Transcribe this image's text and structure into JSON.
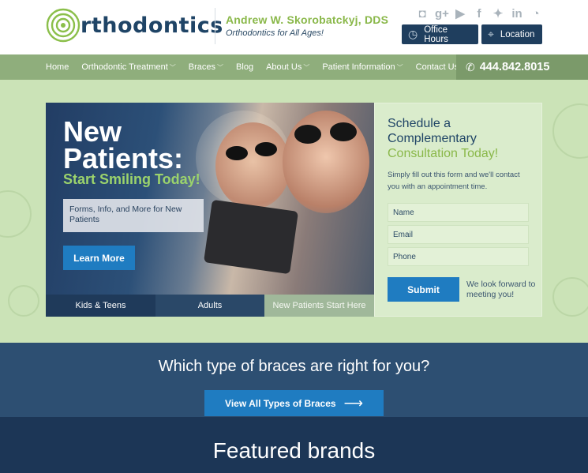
{
  "brand": {
    "logo_text": "rthodontics",
    "doctor_name": "Andrew W. Skorobatckyj, DDS",
    "tagline": "Orthodontics for All Ages!"
  },
  "social": [
    "instagram-icon",
    "google-plus-icon",
    "youtube-icon",
    "facebook-icon",
    "twitter-icon",
    "linkedin-icon",
    "rss-icon"
  ],
  "header_buttons": {
    "office_hours": "Office Hours",
    "location": "Location"
  },
  "nav": {
    "items": [
      {
        "label": "Home",
        "dropdown": false
      },
      {
        "label": "Orthodontic Treatment",
        "dropdown": true
      },
      {
        "label": "Braces",
        "dropdown": true
      },
      {
        "label": "Blog",
        "dropdown": false
      },
      {
        "label": "About Us",
        "dropdown": true
      },
      {
        "label": "Patient Information",
        "dropdown": true
      },
      {
        "label": "Contact Us",
        "dropdown": false
      }
    ],
    "phone": "444.842.8015"
  },
  "hero": {
    "title_line1": "New",
    "title_line2": "Patients:",
    "subtitle": "Start Smiling Today!",
    "box_text": "Forms, Info, and More for New Patients",
    "button": "Learn More",
    "tabs": [
      "Kids & Teens",
      "Adults",
      "New Patients Start Here"
    ]
  },
  "form": {
    "title_line1": "Schedule a",
    "title_line2": "Complementary",
    "title_accent": "Consultation Today!",
    "description": "Simply fill out this form and we'll contact you with an appointment time.",
    "name_placeholder": "Name",
    "email_placeholder": "Email",
    "phone_placeholder": "Phone",
    "submit": "Submit",
    "note": "We look forward to meeting you!"
  },
  "braces": {
    "question": "Which type of braces are right for you?",
    "button": "View All Types of Braces"
  },
  "featured": {
    "title": "Featured brands"
  },
  "colors": {
    "navy": "#1f3e5e",
    "green_accent": "#8ab84a",
    "nav_green": "#8fae7c",
    "button_blue": "#1f7cc1",
    "band_green": "#cbe3b7"
  }
}
